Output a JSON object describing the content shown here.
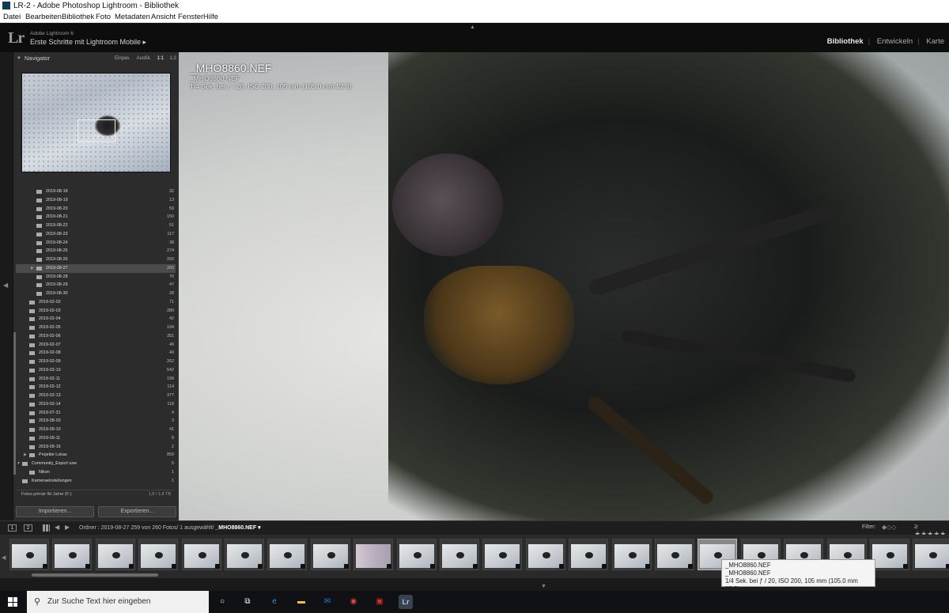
{
  "window": {
    "title": "LR-2 - Adobe Photoshop Lightroom - Bibliothek"
  },
  "menu": [
    "Datei",
    "Bearbeiten",
    "Bibliothek",
    "Foto",
    "Metadaten",
    "Ansicht",
    "Fenster",
    "Hilfe"
  ],
  "identity": {
    "logo": "Lr",
    "version": "Adobe Lightroom 6",
    "mobile": "Erste Schritte mit Lightroom Mobile ▸",
    "modules": [
      "Bibliothek",
      "Entwickeln",
      "Karte"
    ],
    "active_module": "Bibliothek"
  },
  "navigator": {
    "title": "Navigator",
    "options": [
      "Einpas.",
      "Ausfül.",
      "1:1",
      "1:2"
    ],
    "selected_option": "1:1"
  },
  "folders": [
    {
      "name": "2019-08-18",
      "count": "32",
      "level": 2
    },
    {
      "name": "2019-08-19",
      "count": "13",
      "level": 2
    },
    {
      "name": "2019-08-20",
      "count": "59",
      "level": 2
    },
    {
      "name": "2019-08-21",
      "count": "150",
      "level": 2
    },
    {
      "name": "2019-08-22",
      "count": "51",
      "level": 2
    },
    {
      "name": "2019-08-23",
      "count": "117",
      "level": 2
    },
    {
      "name": "2019-08-24",
      "count": "38",
      "level": 2
    },
    {
      "name": "2019-08-25",
      "count": "274",
      "level": 2
    },
    {
      "name": "2019-08-26",
      "count": "250",
      "level": 2
    },
    {
      "name": "2019-08-27",
      "count": "260",
      "level": 2,
      "selected": true
    },
    {
      "name": "2019-08-28",
      "count": "70",
      "level": 2
    },
    {
      "name": "2019-08-29",
      "count": "47",
      "level": 2
    },
    {
      "name": "2019-08-30",
      "count": "28",
      "level": 2
    },
    {
      "name": "2019-02-02",
      "count": "71",
      "level": 1
    },
    {
      "name": "2019-02-03",
      "count": "289",
      "level": 1
    },
    {
      "name": "2019-02-04",
      "count": "42",
      "level": 1
    },
    {
      "name": "2019-02-05",
      "count": "194",
      "level": 1
    },
    {
      "name": "2019-02-06",
      "count": "351",
      "level": 1
    },
    {
      "name": "2019-02-07",
      "count": "49",
      "level": 1
    },
    {
      "name": "2019-02-08",
      "count": "40",
      "level": 1
    },
    {
      "name": "2019-02-09",
      "count": "262",
      "level": 1
    },
    {
      "name": "2019-02-10",
      "count": "542",
      "level": 1
    },
    {
      "name": "2019-02-11",
      "count": "199",
      "level": 1
    },
    {
      "name": "2019-02-12",
      "count": "114",
      "level": 1
    },
    {
      "name": "2019-02-13",
      "count": "377",
      "level": 1
    },
    {
      "name": "2019-02-14",
      "count": "118",
      "level": 1
    },
    {
      "name": "2019-07-31",
      "count": "4",
      "level": 1
    },
    {
      "name": "2019-08-20",
      "count": "3",
      "level": 1
    },
    {
      "name": "2019-09-10",
      "count": "41",
      "level": 1
    },
    {
      "name": "2019-09-11",
      "count": "8",
      "level": 1
    },
    {
      "name": "2019-09-16",
      "count": "2",
      "level": 1
    },
    {
      "name": "Projekte Lukas",
      "count": "859",
      "level": 1,
      "expandable": true
    },
    {
      "name": "Community_Export usw",
      "count": "5",
      "level": 0,
      "expanded": true
    },
    {
      "name": "Nikon",
      "count": "1",
      "level": 1
    },
    {
      "name": "Kameraeinstellungen",
      "count": "1",
      "level": 0
    }
  ],
  "drive": {
    "name": "Fotos primär lfd Jahre (F:)",
    "count": "1,8 / 1,8 TB"
  },
  "buttons": {
    "import": "Importieren...",
    "export": "Exportieren..."
  },
  "photo_info": {
    "filename": "_MHO8860.NEF",
    "line2": "_MHO8860.NEF",
    "line3": "1/4 Sek. bei ƒ / 20, ISO 200, 105 mm (105.0 mm f/2.8)"
  },
  "toolbar": {
    "view1": "1",
    "view2": "2",
    "breadcrumb_prefix": "Ordner : 2019-08-27   259 von 260 Fotos/ 1 ausgewählt/ ",
    "breadcrumb_file": "_MHO8860.NEF ▾",
    "filter_label": "Filter:",
    "stars": "≥ ★★★★★"
  },
  "filmstrip": {
    "count": 22,
    "selected_index": 16,
    "blurred_index": 8
  },
  "tooltip": {
    "line1": "_MHO8860.NEF",
    "line2": "_MHO8860.NEF",
    "line3": "1/4 Sek. bei ƒ / 20, ISO 200, 105 mm (105.0 mm f/2.8)"
  },
  "taskbar": {
    "search_placeholder": "Zur Suche Text hier eingeben",
    "apps": [
      "cortana-icon",
      "task-view-icon",
      "edge-icon",
      "file-explorer-icon",
      "outlook-icon",
      "chrome-icon",
      "acrobat-icon",
      "lightroom-icon"
    ]
  }
}
